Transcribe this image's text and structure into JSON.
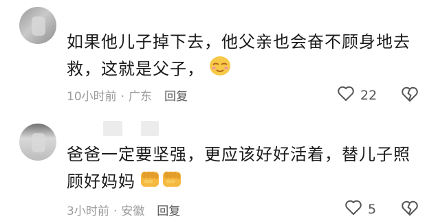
{
  "comments": [
    {
      "text": "如果他儿子掉下去，他父亲也会奋不顾身地去救，这就是父子，",
      "time": "10小时前",
      "location": "广东",
      "reply": "回复",
      "likes": "22",
      "emoji": "smiling-face-icon"
    },
    {
      "text": "爸爸一定要坚强，更应该好好活着，替儿子照顾好妈妈",
      "time": "3小时前",
      "location": "安徽",
      "reply": "回复",
      "likes": "5",
      "emoji": "raised-fist-icon"
    }
  ],
  "separator": "·"
}
